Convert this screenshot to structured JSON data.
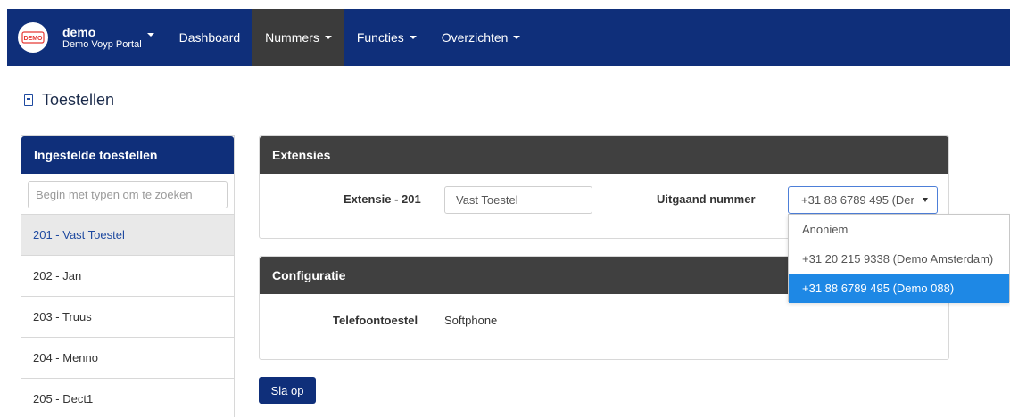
{
  "navbar": {
    "brand_name": "demo",
    "brand_sub": "Demo Voyp Portal",
    "logo_text": "DEMO",
    "items": [
      {
        "label": "Dashboard"
      },
      {
        "label": "Nummers"
      },
      {
        "label": "Functies"
      },
      {
        "label": "Overzichten"
      }
    ]
  },
  "page": {
    "title": "Toestellen"
  },
  "left_panel": {
    "title": "Ingestelde toestellen",
    "search_placeholder": "Begin met typen om te zoeken",
    "devices": [
      "201 - Vast Toestel",
      "202 - Jan",
      "203 - Truus",
      "204 - Menno",
      "205 - Dect1"
    ],
    "selected_index": 0
  },
  "extensies": {
    "title": "Extensies",
    "extension_label": "Extensie - 201",
    "extension_value": "Vast Toestel",
    "outgoing_label": "Uitgaand nummer",
    "outgoing_selected": "+31 88 6789 495 (Demo 088)",
    "options": [
      "Anoniem",
      "+31 20 215 9338 (Demo Amsterdam)",
      "+31 88 6789 495 (Demo 088)"
    ]
  },
  "configuratie": {
    "title": "Configuratie",
    "phone_label": "Telefoontoestel",
    "phone_value": "Softphone"
  },
  "actions": {
    "save_label": "Sla op"
  },
  "colors": {
    "navbar": "#0f2f7a",
    "active_nav": "#3b3b3b",
    "panel_header": "#404040",
    "selected_option": "#1e88e5"
  }
}
